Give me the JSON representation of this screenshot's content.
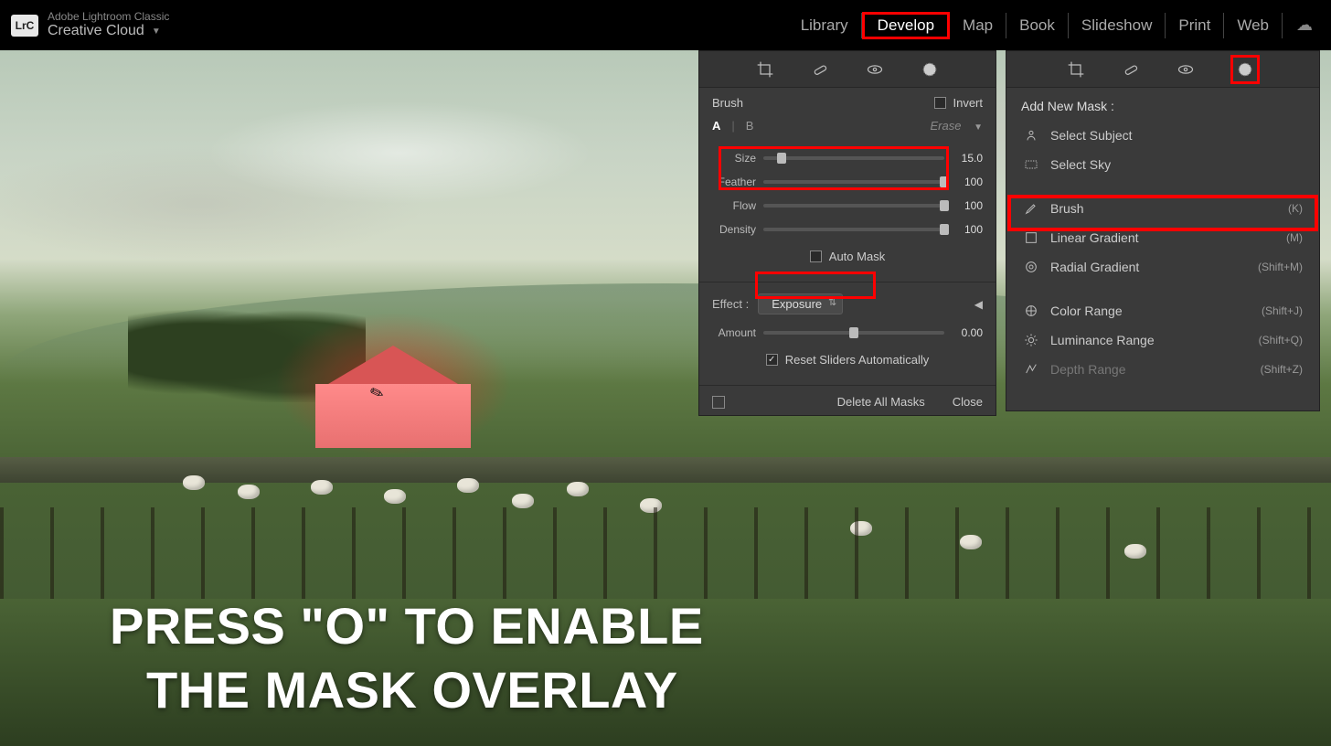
{
  "app": {
    "title": "Adobe Lightroom Classic",
    "cloud": "Creative Cloud",
    "logo": "LrC"
  },
  "modules": {
    "items": [
      "Library",
      "Develop",
      "Map",
      "Book",
      "Slideshow",
      "Print",
      "Web"
    ],
    "active": "Develop"
  },
  "caption": {
    "line1": "PRESS \"O\" TO ENABLE",
    "line2": "THE MASK OVERLAY"
  },
  "brush_panel": {
    "title": "Brush",
    "invert": "Invert",
    "tab_a": "A",
    "tab_b": "B",
    "erase": "Erase",
    "sliders": {
      "size": {
        "label": "Size",
        "value": "15.0",
        "pct": 10
      },
      "feather": {
        "label": "Feather",
        "value": "100",
        "pct": 100
      },
      "flow": {
        "label": "Flow",
        "value": "100",
        "pct": 100
      },
      "density": {
        "label": "Density",
        "value": "100",
        "pct": 100
      }
    },
    "auto_mask": "Auto Mask",
    "effect_label": "Effect :",
    "effect_value": "Exposure",
    "amount": {
      "label": "Amount",
      "value": "0.00",
      "pct": 50
    },
    "reset": "Reset Sliders Automatically",
    "delete_all": "Delete All Masks",
    "close": "Close"
  },
  "mask_panel": {
    "title": "Add New Mask :",
    "items": [
      {
        "label": "Select Subject",
        "shortcut": ""
      },
      {
        "label": "Select Sky",
        "shortcut": ""
      },
      {
        "label": "Brush",
        "shortcut": "(K)"
      },
      {
        "label": "Linear Gradient",
        "shortcut": "(M)"
      },
      {
        "label": "Radial Gradient",
        "shortcut": "(Shift+M)"
      },
      {
        "label": "Color Range",
        "shortcut": "(Shift+J)"
      },
      {
        "label": "Luminance Range",
        "shortcut": "(Shift+Q)"
      },
      {
        "label": "Depth Range",
        "shortcut": "(Shift+Z)"
      }
    ]
  },
  "highlight_color": "#ff0000"
}
